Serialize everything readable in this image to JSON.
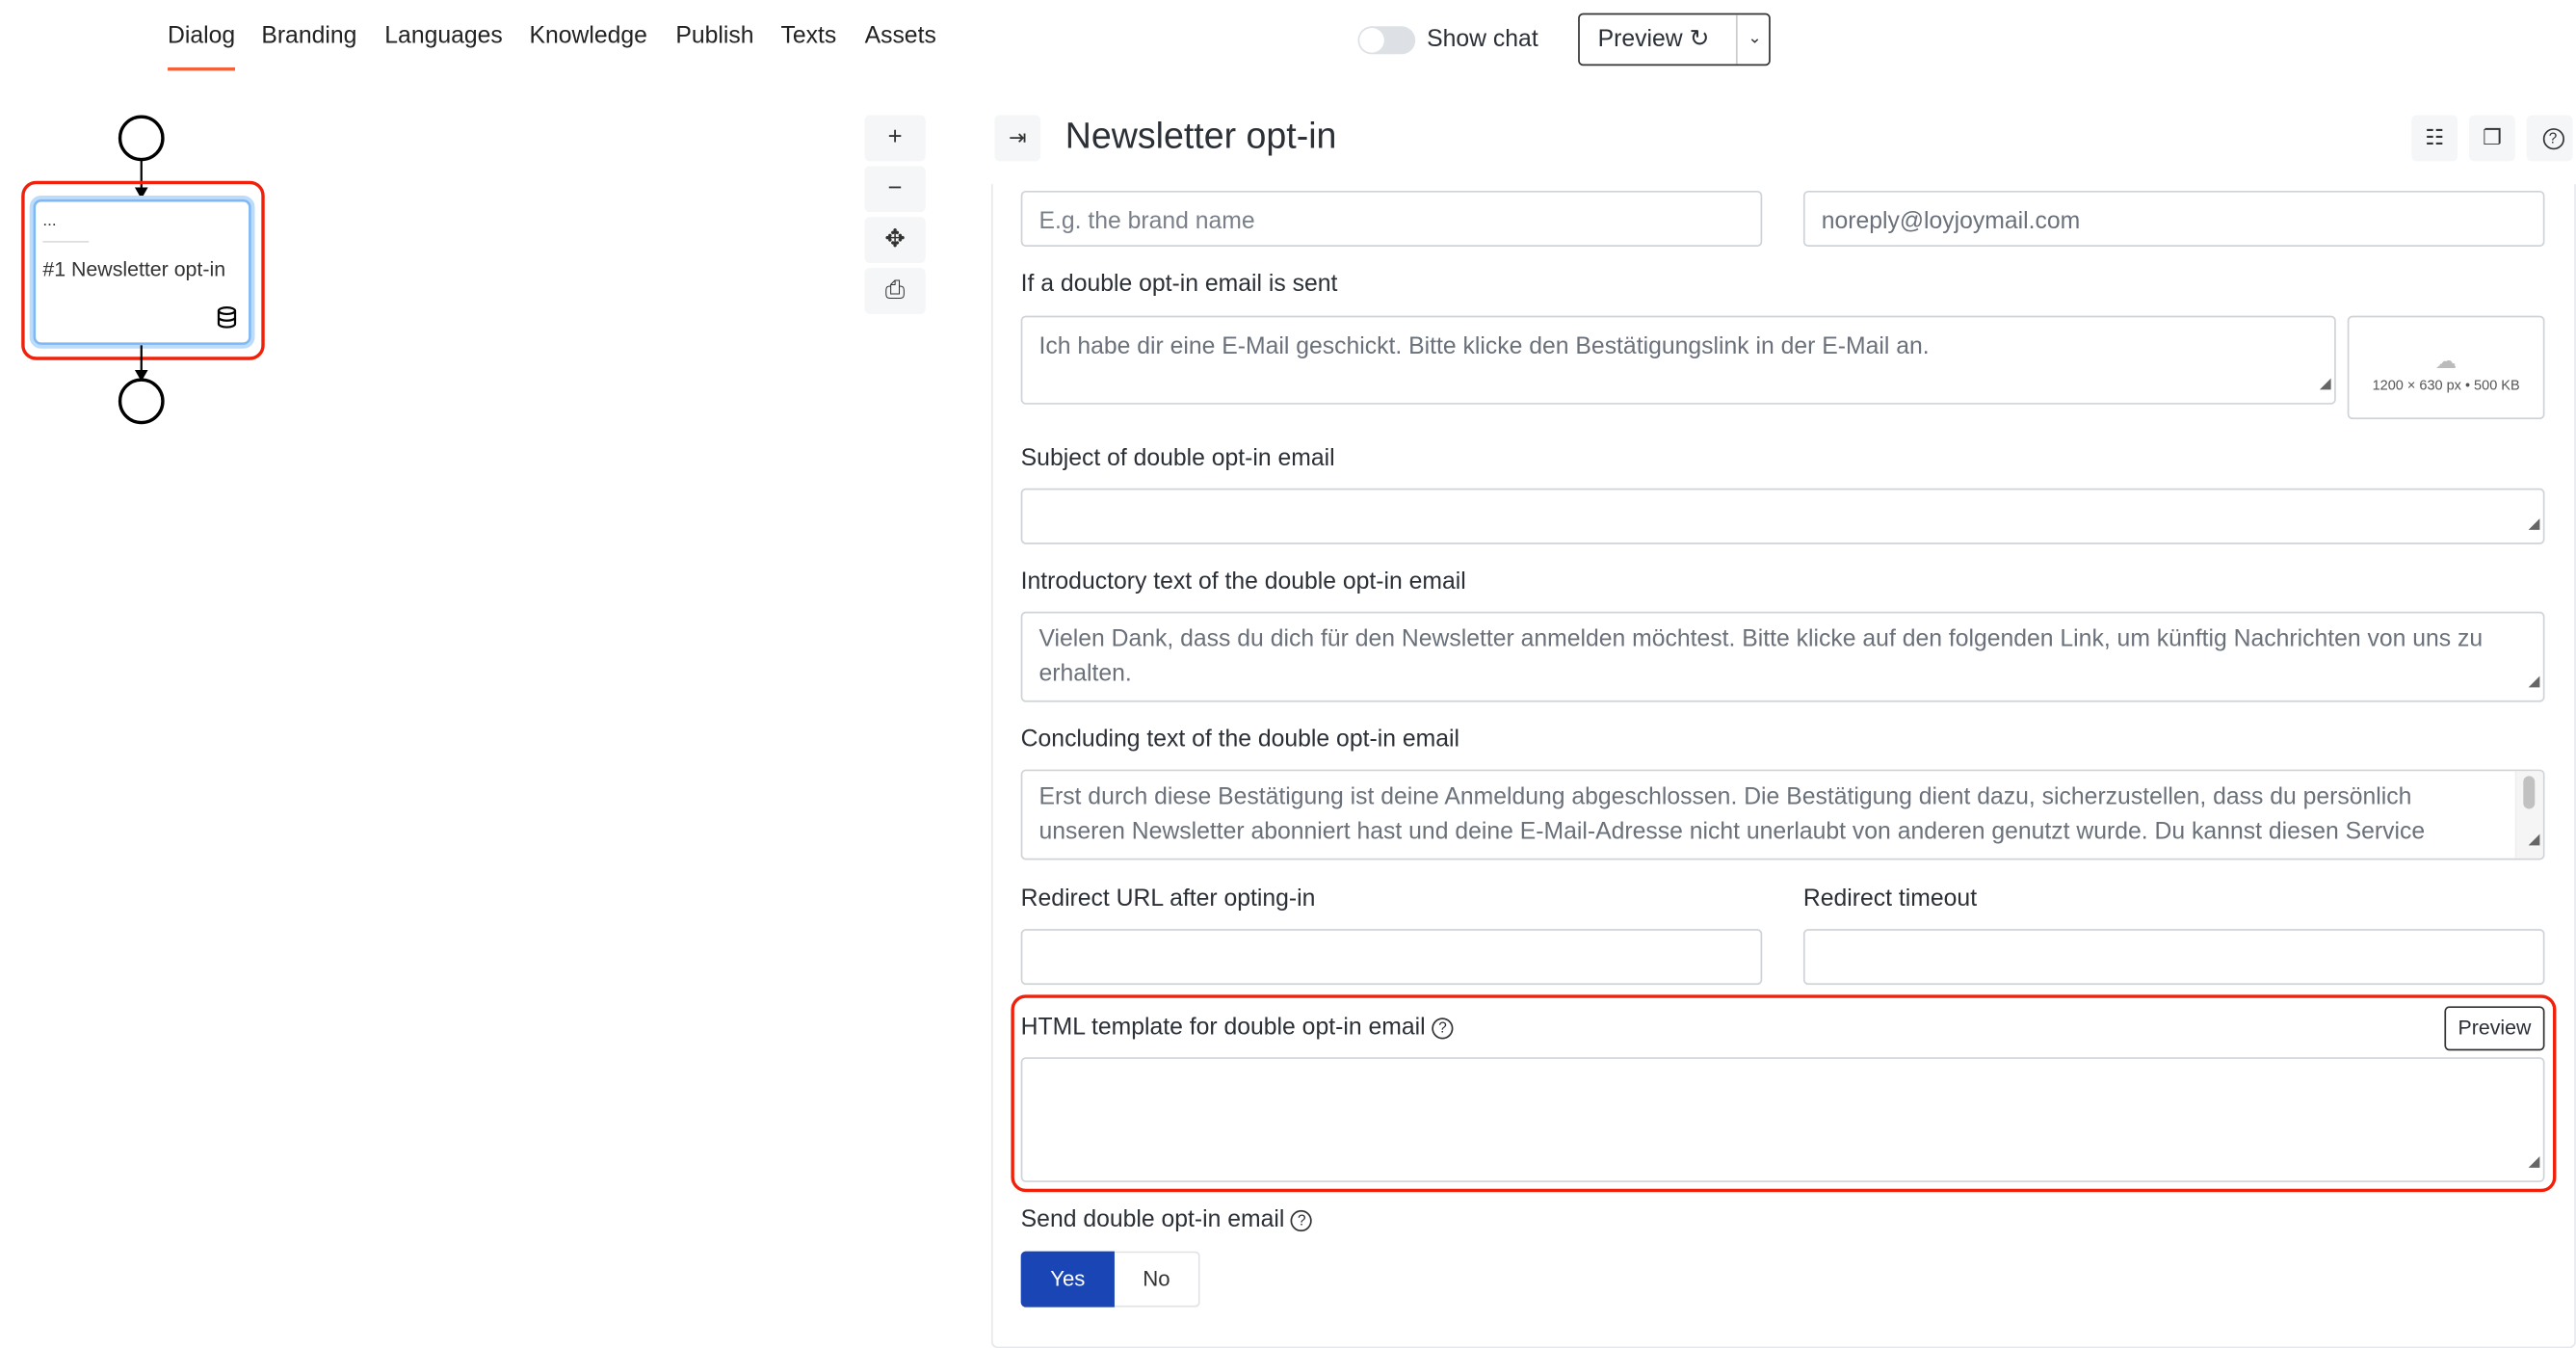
{
  "nav": {
    "tabs": [
      {
        "label": "Dialog",
        "active": true
      },
      {
        "label": "Branding"
      },
      {
        "label": "Languages"
      },
      {
        "label": "Knowledge"
      },
      {
        "label": "Publish"
      },
      {
        "label": "Texts"
      },
      {
        "label": "Assets"
      }
    ]
  },
  "header": {
    "show_chat_label": "Show chat",
    "show_chat_on": false,
    "preview_label": "Preview",
    "refresh_icon": "↻",
    "chevron_icon": "⌄"
  },
  "flow": {
    "node_dots": "...",
    "node_label": "#1 Newsletter opt-in",
    "node_icon": "database-icon"
  },
  "zoom_controls": {
    "zoom_in": "+",
    "zoom_out": "−",
    "fit": "✥",
    "print": "⎙"
  },
  "panel": {
    "title": "Newsletter opt-in",
    "sender_name_placeholder": "E.g. the brand name",
    "sender_email_value": "noreply@loyjoymail.com",
    "sent_label": "If a double opt-in email is sent",
    "sent_value": "Ich habe dir eine E-Mail geschickt. Bitte klicke den Bestätigungslink in der E-Mail an.",
    "image_hint": "1200 × 630 px • 500 KB",
    "subject_label": "Subject of double opt-in email",
    "subject_value": "",
    "intro_label": "Introductory text of the double opt-in email",
    "intro_value": "Vielen Dank, dass du dich für den Newsletter anmelden möchtest. Bitte klicke auf den folgenden Link, um künftig Nachrichten von uns zu erhalten.",
    "concluding_label": "Concluding text of the double opt-in email",
    "concluding_value": "Erst durch diese Bestätigung ist deine Anmeldung abgeschlossen. Die Bestätigung dient dazu, sicherzustellen, dass du persönlich unseren Newsletter abonniert hast und deine E-Mail-Adresse nicht unerlaubt von anderen genutzt wurde. Du kannst diesen Service",
    "redirect_url_label": "Redirect URL after opting-in",
    "redirect_timeout_label": "Redirect timeout",
    "html_template_label": "HTML template for double opt-in email",
    "html_preview_label": "Preview",
    "send_label": "Send double opt-in email",
    "yes_label": "Yes",
    "no_label": "No",
    "send_selected": "Yes"
  },
  "colors": {
    "accent": "#f4623a",
    "primary": "#1a45b4",
    "highlight": "#f0200a",
    "node_border": "#7fb8f5"
  }
}
